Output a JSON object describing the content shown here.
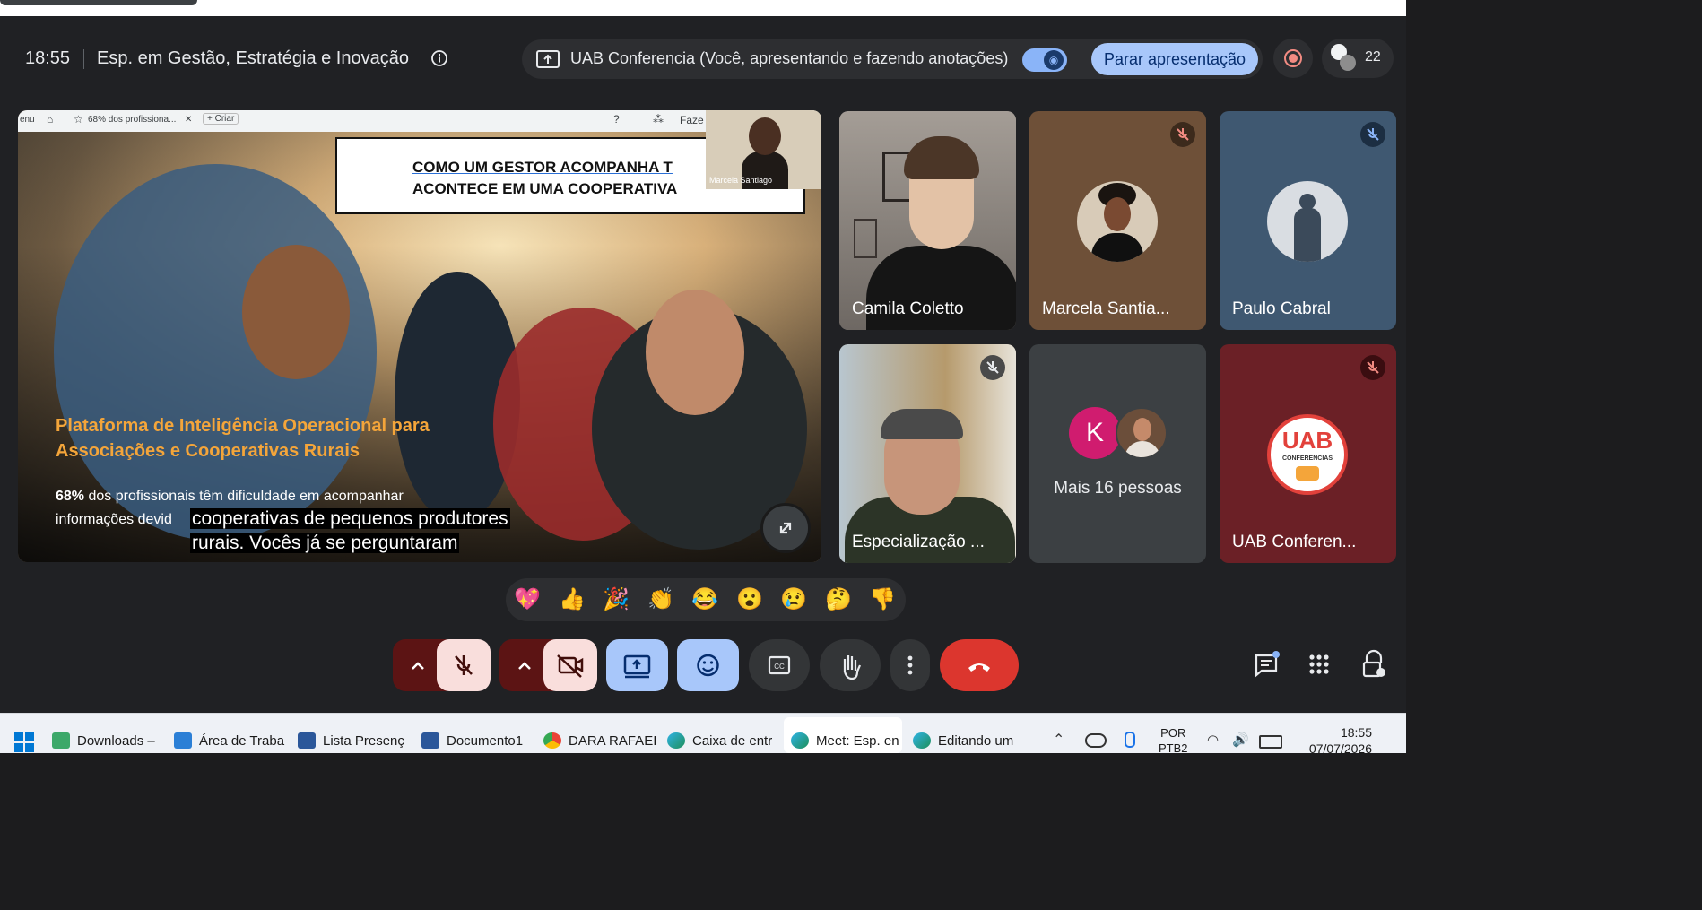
{
  "header": {
    "time": "18:55",
    "meeting_title": "Esp. em Gestão, Estratégia e Inovação",
    "presenting_text": "UAB Conferencia (Você, apresentando e fazendo anotações)",
    "stop_presenting_label": "Parar apresentação",
    "participant_count": "22"
  },
  "slide": {
    "tab_left": "enu",
    "tab_title": "68% dos profissiona...",
    "tab_new": "+ Criar",
    "tab_right": "Faze",
    "title_line1": "COMO UM GESTOR ACOMPANHA T",
    "title_line2": "ACONTECE EM UMA COOPERATIVA",
    "presenter_name": "Marcela Santiago",
    "orange_line1": "Plataforma de Inteligência Operacional para",
    "orange_line2": "Associações e Cooperativas Rurais",
    "body_bold": "68%",
    "body_line1_rest": " dos profissionais têm dificuldade em acompanhar",
    "body_line2": "informações devid",
    "caption_line1": "cooperativas de pequenos produtores",
    "caption_line2": "rurais. Vocês já se perguntaram"
  },
  "participants": [
    {
      "name": "Camila Coletto",
      "muted": false
    },
    {
      "name": "Marcela Santia...",
      "muted": true
    },
    {
      "name": "Paulo Cabral",
      "muted": true
    },
    {
      "name": "Especialização ...",
      "muted": true
    },
    {
      "name": "Mais 16 pessoas",
      "initial": "K",
      "muted": false
    },
    {
      "name": "UAB Conferen...",
      "logo_text": "UAB",
      "logo_sub": "CONFERENCIAS",
      "muted": true
    }
  ],
  "reactions": [
    "💖",
    "👍",
    "🎉",
    "👏",
    "😂",
    "😮",
    "😢",
    "🤔",
    "👎"
  ],
  "taskbar": {
    "items": [
      "Downloads –",
      "Área de Traba",
      "Lista Presenç",
      "Documento1",
      "DARA RAFAEI",
      "Caixa de entr",
      "Meet: Esp. en",
      "Editando um"
    ],
    "lang1": "POR",
    "lang2": "PTB2",
    "clock_time": "18:55",
    "clock_date": "07/07/2026"
  },
  "colors": {
    "meet_bg": "#202124",
    "accent_blue": "#a8c7fa",
    "danger_red": "#ea4335",
    "muted_red_ctl": "#5c1414"
  }
}
